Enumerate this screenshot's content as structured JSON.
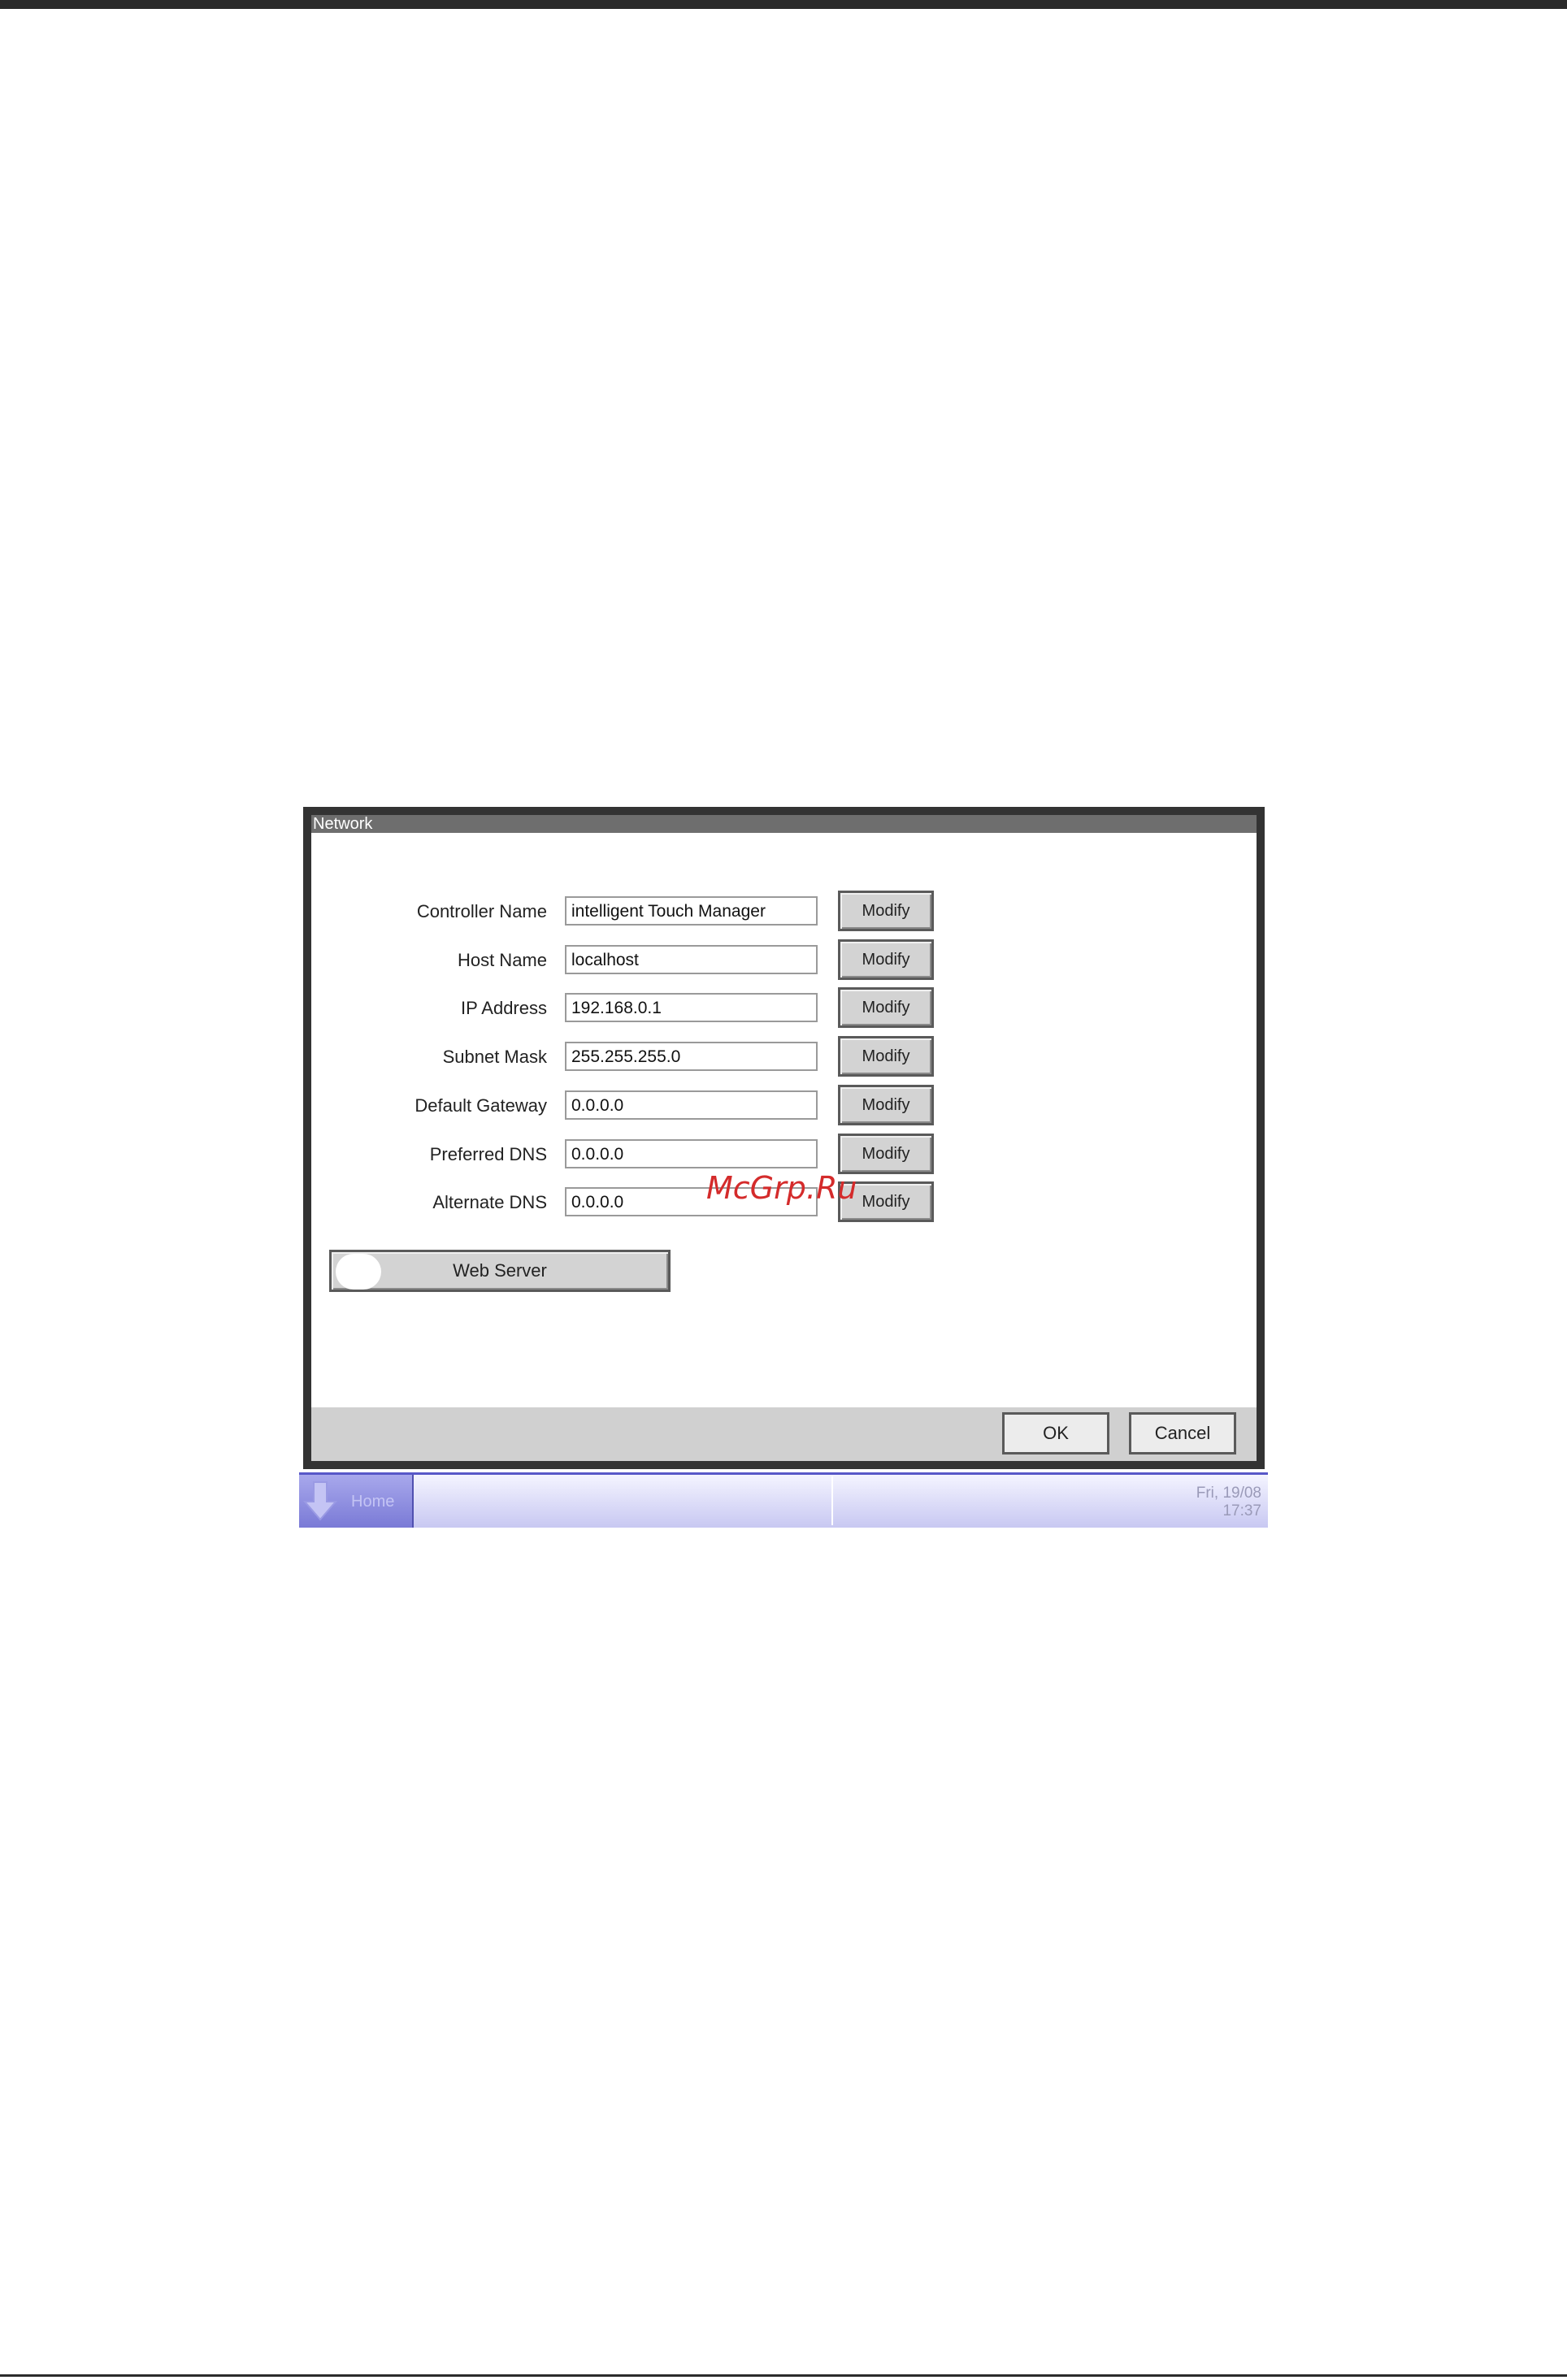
{
  "dialog": {
    "title": "Network",
    "rows": [
      {
        "label": "Controller Name",
        "value": "intelligent Touch Manager",
        "button": "Modify"
      },
      {
        "label": "Host Name",
        "value": "localhost",
        "button": "Modify"
      },
      {
        "label": "IP Address",
        "value": "192.168.0.1",
        "button": "Modify"
      },
      {
        "label": "Subnet Mask",
        "value": "255.255.255.0",
        "button": "Modify"
      },
      {
        "label": "Default Gateway",
        "value": "0.0.0.0",
        "button": "Modify"
      },
      {
        "label": "Preferred DNS",
        "value": "0.0.0.0",
        "button": "Modify"
      },
      {
        "label": "Alternate DNS",
        "value": "0.0.0.0",
        "button": "Modify"
      }
    ],
    "web_server": {
      "label": "Web Server"
    },
    "footer": {
      "ok": "OK",
      "cancel": "Cancel"
    }
  },
  "taskbar": {
    "home_label": "Home",
    "date": "Fri, 19/08",
    "time": "17:37"
  },
  "watermark": "McGrp.Ru"
}
